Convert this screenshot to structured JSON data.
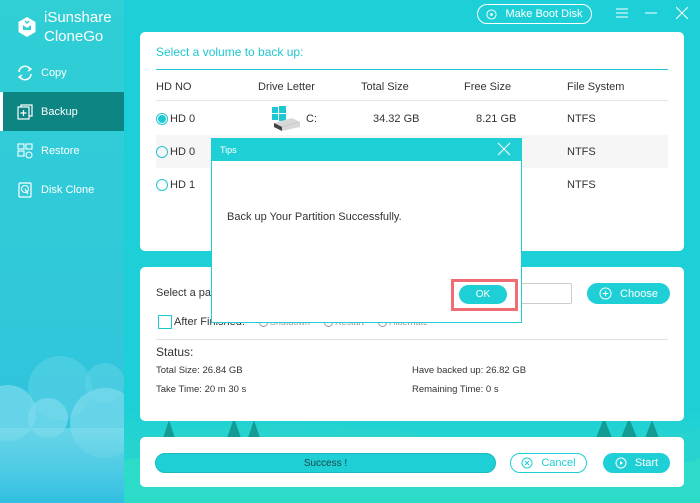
{
  "app": {
    "name_line1": "iSunshare",
    "name_line2": "CloneGo",
    "logo_icon": "hexagon-logo-icon"
  },
  "sidebar": {
    "items": [
      {
        "label": "Copy",
        "icon": "sync-icon",
        "active": false
      },
      {
        "label": "Backup",
        "icon": "backup-plus-icon",
        "active": true
      },
      {
        "label": "Restore",
        "icon": "restore-icon",
        "active": false
      },
      {
        "label": "Disk Clone",
        "icon": "disk-clone-icon",
        "active": false
      }
    ]
  },
  "topbar": {
    "make_boot_disk": "Make Boot Disk",
    "menu_icon": "menu-icon",
    "minimize_icon": "minimize-icon",
    "close_icon": "close-icon"
  },
  "volume_section": {
    "title": "Select a volume to back up:",
    "columns": [
      "HD NO",
      "Drive Letter",
      "Total Size",
      "Free Size",
      "File System"
    ],
    "rows": [
      {
        "hd": "HD 0",
        "selected": true,
        "drive": "C:",
        "total": "34.32 GB",
        "free": "8.21 GB",
        "fs": "NTFS"
      },
      {
        "hd": "HD 0",
        "selected": false,
        "drive": "",
        "total": "",
        "free": "",
        "fs": "NTFS"
      },
      {
        "hd": "HD 1",
        "selected": false,
        "drive": "",
        "total": "",
        "free": "",
        "fs": "NTFS"
      }
    ]
  },
  "path_section": {
    "label": "Select a pa",
    "path_value": "",
    "choose_label": "Choose",
    "after_finished_label": "After Finished:",
    "after_options": [
      "Shutdown",
      "Restart",
      "Hibernate"
    ]
  },
  "status": {
    "title": "Status:",
    "total_size": "Total Size: 26.84 GB",
    "have_backed_up": "Have backed up: 26.82 GB",
    "take_time": "Take Time: 20 m 30 s",
    "remaining_time": "Remaining Time: 0 s"
  },
  "actions": {
    "progress_text": "Success !",
    "progress_percent": 100,
    "cancel_label": "Cancel",
    "start_label": "Start"
  },
  "dialog": {
    "title": "Tips",
    "message": "Back up Your Partition Successfully.",
    "ok_label": "OK"
  },
  "colors": {
    "accent": "#1fcfd6",
    "active_nav": "#0d8582",
    "highlight": "#ef6c74"
  }
}
